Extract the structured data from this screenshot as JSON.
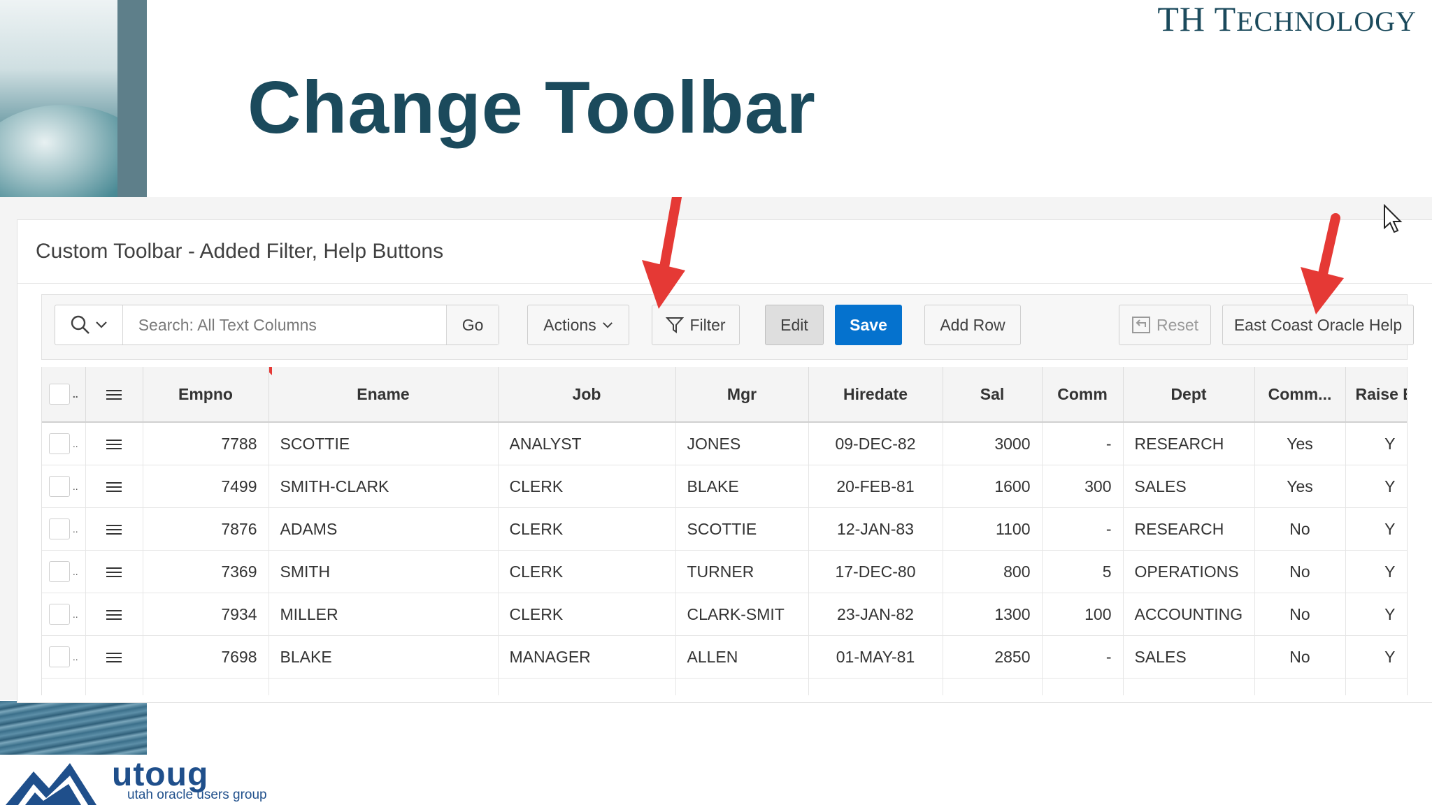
{
  "slide": {
    "title": "Change Toolbar",
    "brand_first": "TH T",
    "brand_rest": "ECHNOLOGY",
    "logo_text": "utoug",
    "logo_subtitle": "utah oracle users group"
  },
  "region": {
    "title": "Custom Toolbar - Added Filter, Help Buttons"
  },
  "toolbar": {
    "search_placeholder": "Search: All Text Columns",
    "go_label": "Go",
    "actions_label": "Actions",
    "filter_label": "Filter",
    "edit_label": "Edit",
    "save_label": "Save",
    "add_row_label": "Add Row",
    "reset_label": "Reset",
    "help_label": "East Coast Oracle Help"
  },
  "grid": {
    "selector_header": "..",
    "columns": [
      "Empno",
      "Ename",
      "Job",
      "Mgr",
      "Hiredate",
      "Sal",
      "Comm",
      "Dept",
      "Comm...",
      "Raise E"
    ],
    "rows": [
      {
        "empno": "7788",
        "ename": "SCOTTIE",
        "job": "ANALYST",
        "mgr": "JONES",
        "hiredate": "09-DEC-82",
        "sal": "3000",
        "comm": "-",
        "dept": "RESEARCH",
        "commflag": "Yes",
        "raise": "Y"
      },
      {
        "empno": "7499",
        "ename": "SMITH-CLARK",
        "job": "CLERK",
        "mgr": "BLAKE",
        "hiredate": "20-FEB-81",
        "sal": "1600",
        "comm": "300",
        "dept": "SALES",
        "commflag": "Yes",
        "raise": "Y"
      },
      {
        "empno": "7876",
        "ename": "ADAMS",
        "job": "CLERK",
        "mgr": "SCOTTIE",
        "hiredate": "12-JAN-83",
        "sal": "1100",
        "comm": "-",
        "dept": "RESEARCH",
        "commflag": "No",
        "raise": "Y"
      },
      {
        "empno": "7369",
        "ename": "SMITH",
        "job": "CLERK",
        "mgr": "TURNER",
        "hiredate": "17-DEC-80",
        "sal": "800",
        "comm": "5",
        "dept": "OPERATIONS",
        "commflag": "No",
        "raise": "Y"
      },
      {
        "empno": "7934",
        "ename": "MILLER",
        "job": "CLERK",
        "mgr": "CLARK-SMIT",
        "hiredate": "23-JAN-82",
        "sal": "1300",
        "comm": "100",
        "dept": "ACCOUNTING",
        "commflag": "No",
        "raise": "Y"
      },
      {
        "empno": "7698",
        "ename": "BLAKE",
        "job": "MANAGER",
        "mgr": "ALLEN",
        "hiredate": "01-MAY-81",
        "sal": "2850",
        "comm": "-",
        "dept": "SALES",
        "commflag": "No",
        "raise": "Y"
      }
    ]
  },
  "colors": {
    "title": "#1b4a5c",
    "save_button": "#0572ce",
    "annotation_arrow": "#e53935"
  },
  "icons": {
    "search": "search-icon",
    "chevron": "chevron-down-icon",
    "filter": "funnel-icon",
    "reset": "undo-icon",
    "row_actions": "hamburger-menu-icon"
  }
}
